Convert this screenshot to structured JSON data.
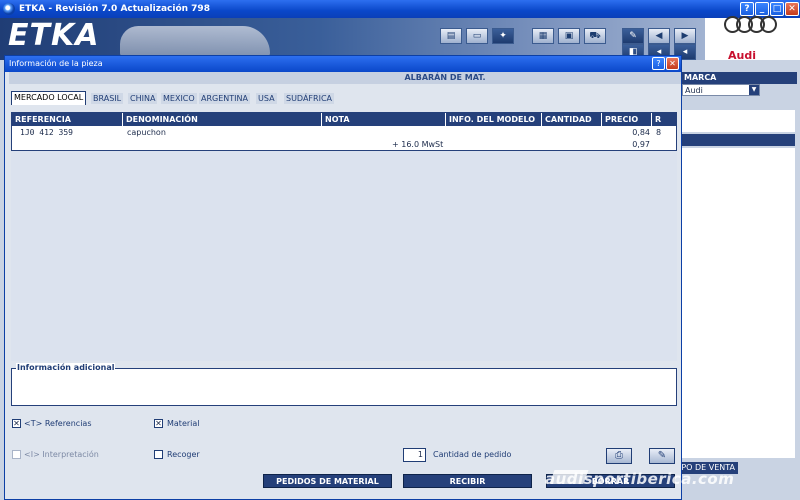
{
  "window": {
    "title": "ETKA - Revisión 7.0 Actualización 798",
    "btn_help": "?",
    "btn_min": "_",
    "btn_max": "□",
    "btn_close": "✕"
  },
  "banner": {
    "logo_text": "ETKA",
    "brand_name": "Audi"
  },
  "right_panel": {
    "marca_label": "MARCA",
    "marca_value": "Audi",
    "punto_venta": "PO DE VENTA"
  },
  "watermark": "audisportiberica.com",
  "dialog": {
    "title": "Información de la pieza",
    "section_title": "ALBARÁN DE MAT.",
    "tabs": [
      "MERCADO LOCAL",
      "BRASIL",
      "CHINA",
      "MEXICO",
      "ARGENTINA",
      "USA",
      "SUDÁFRICA"
    ],
    "columns": [
      "REFERENCIA",
      "DENOMINACIÓN",
      "NOTA",
      "INFO. DEL MODELO",
      "CANTIDAD",
      "PRECIO",
      "R"
    ],
    "rows": [
      {
        "referencia": "1J0 412 359",
        "denominacion": "capuchon",
        "nota": "",
        "info_modelo": "",
        "cantidad": "",
        "precio": "0,84",
        "r": "8"
      },
      {
        "referencia": "",
        "denominacion": "",
        "nota": "+ 16.0 MwSt",
        "info_modelo": "",
        "cantidad": "",
        "precio": "0,97",
        "r": ""
      }
    ],
    "additional_info_label": "Información adicional",
    "checkboxes": {
      "referencias": {
        "label": "<T> Referencias",
        "checked": true
      },
      "material": {
        "label": "Material",
        "checked": true
      },
      "interpretacion": {
        "label": "<I> Interpretación",
        "checked": false
      },
      "recoger": {
        "label": "Recoger",
        "checked": false
      }
    },
    "quantity": {
      "label": "Cantidad de pedido",
      "value": "1"
    },
    "buttons": {
      "pedidos": "PEDIDOS DE MATERIAL",
      "recibir": "RECIBIR",
      "third": "BORRAR"
    },
    "icons": {
      "print": "printer-icon",
      "edit": "edit-icon"
    }
  }
}
